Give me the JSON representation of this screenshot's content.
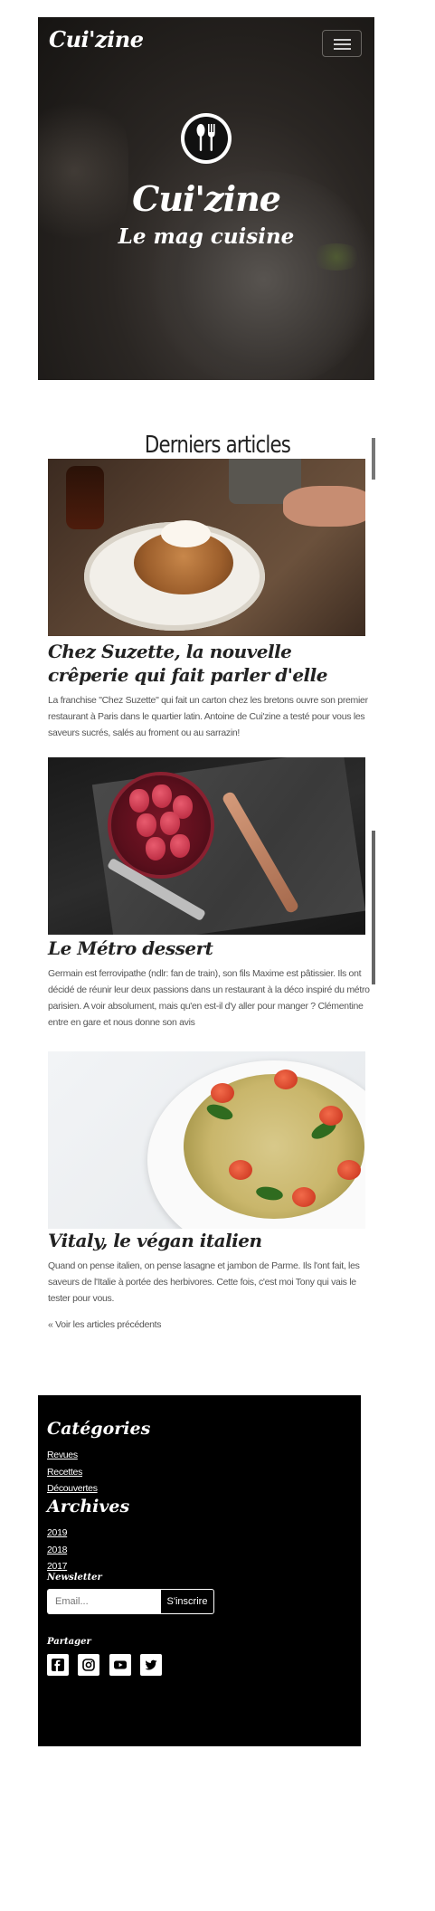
{
  "brand": "Cui'zine",
  "nav": {
    "toggler_icon": "hamburger-icon"
  },
  "hero": {
    "logo_icon": "fork-spoon-icon",
    "title": "Cui'zine",
    "subtitle": "Le mag cuisine"
  },
  "articles_section": {
    "title": "Derniers articles",
    "items": [
      {
        "image": "pancakes-photo",
        "title": "Chez Suzette, la nouvelle crêperie qui fait parler d'elle",
        "excerpt": "La franchise \"Chez Suzette\" qui fait un carton chez les bretons ouvre son premier restaurant à Paris dans le quartier latin. Antoine de Cui'zine a testé pour vous les saveurs sucrés, salés au froment ou au sarrazin!"
      },
      {
        "image": "strawberries-photo",
        "title": "Le Métro dessert",
        "excerpt": "Germain est ferrovipathe (ndlr: fan de train), son fils Maxime est pâtissier. Ils ont décidé de réunir leur deux passions dans un restaurant à la déco inspiré du métro parisien. A voir absolument, mais qu'en est-il d'y aller pour manger ? Clémentine entre en gare et nous donne son avis"
      },
      {
        "image": "pasta-salad-photo",
        "title": "Vitaly, le végan italien",
        "excerpt": "Quand on pense italien, on pense lasagne et jambon de Parme. Ils l'ont fait, les saveurs de l'Italie à portée des herbivores. Cette fois, c'est moi Tony qui vais le tester pour vous."
      }
    ],
    "prev_link": "« Voir les articles précédents"
  },
  "footer": {
    "categories": {
      "title": "Catégories",
      "items": [
        "Revues",
        "Recettes",
        "Découvertes"
      ]
    },
    "archives": {
      "title": "Archives",
      "items": [
        "2019",
        "2018",
        "2017"
      ]
    },
    "newsletter": {
      "title": "Newsletter",
      "placeholder": "Email...",
      "button": "S'inscrire"
    },
    "share": {
      "title": "Partager",
      "icons": [
        "facebook-icon",
        "instagram-icon",
        "youtube-icon",
        "twitter-icon"
      ]
    }
  },
  "colors": {
    "footer_bg": "#000000",
    "hero_overlay": "#1b1816",
    "text": "#222222",
    "muted": "#555555"
  }
}
